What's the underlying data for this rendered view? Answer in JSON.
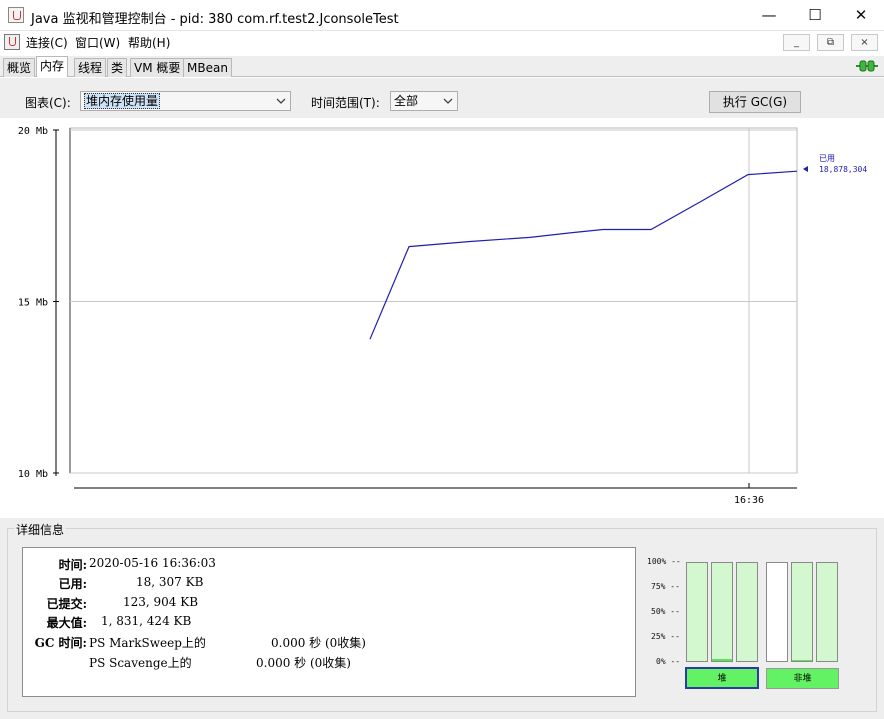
{
  "window": {
    "title": "Java 监视和管理控制台 - pid: 380 com.rf.test2.JconsoleTest",
    "min_glyph": "—",
    "max_glyph": "☐",
    "close_glyph": "✕"
  },
  "menu": {
    "items": [
      "连接(C)",
      "窗口(W)",
      "帮助(H)"
    ],
    "mini_buttons": [
      "_",
      "⧉",
      "×"
    ]
  },
  "tabs": [
    "概览",
    "内存",
    "线程",
    "类",
    "VM 概要",
    "MBean"
  ],
  "active_tab": "内存",
  "controls": {
    "chart_label": "图表(C):",
    "chart_value": "堆内存使用量",
    "range_label": "时间范围(T):",
    "range_value": "全部",
    "gc_button": "执行 GC(G)"
  },
  "chart_data": {
    "type": "line",
    "yticks": [
      "20 Mb",
      "15 Mb",
      "10 Mb"
    ],
    "ylim": [
      10,
      20
    ],
    "xtick": "16:36",
    "series": [
      {
        "name": "已用",
        "value_label": "18,878,304",
        "points": [
          [
            0,
            13.9
          ],
          [
            1,
            16.6
          ],
          [
            2,
            16.75
          ],
          [
            3,
            16.87
          ],
          [
            4,
            17.0
          ],
          [
            5,
            17.1
          ],
          [
            6,
            17.1
          ],
          [
            7,
            17.9
          ],
          [
            8,
            18.7
          ],
          [
            9,
            18.8
          ]
        ]
      }
    ],
    "colors": {
      "line": "#1f1fb0",
      "grid": "#c8c8c8"
    },
    "grid": true
  },
  "details": {
    "title": "详细信息",
    "rows": [
      {
        "key": "时间:",
        "value": "2020-05-16 16:36:03"
      },
      {
        "key": "已用:",
        "value": "18, 307 KB"
      },
      {
        "key": "已提交:",
        "value": "123, 904 KB"
      },
      {
        "key": "最大值:",
        "value": "1, 831, 424 KB"
      },
      {
        "key": "GC 时间:",
        "value": "PS MarkSweep上的"
      }
    ],
    "gc": [
      {
        "name": "PS MarkSweep上的",
        "time": "0.000 秒 (0收集)"
      },
      {
        "name": "PS Scavenge上的",
        "time": "0.000 秒 (0收集)"
      }
    ]
  },
  "pools": {
    "pct_labels": [
      "100% --",
      "75% --",
      "50% --",
      "25% --",
      "0% --"
    ],
    "bars": [
      {
        "level": 0.0,
        "style": "green"
      },
      {
        "level": 0.02,
        "style": "green"
      },
      {
        "level": 0.0,
        "style": "green"
      },
      {
        "level": 0.0,
        "style": "white"
      },
      {
        "level": 0.01,
        "style": "green"
      },
      {
        "level": 0.0,
        "style": "green"
      }
    ],
    "heap_label": "堆",
    "nonheap_label": "非堆"
  }
}
